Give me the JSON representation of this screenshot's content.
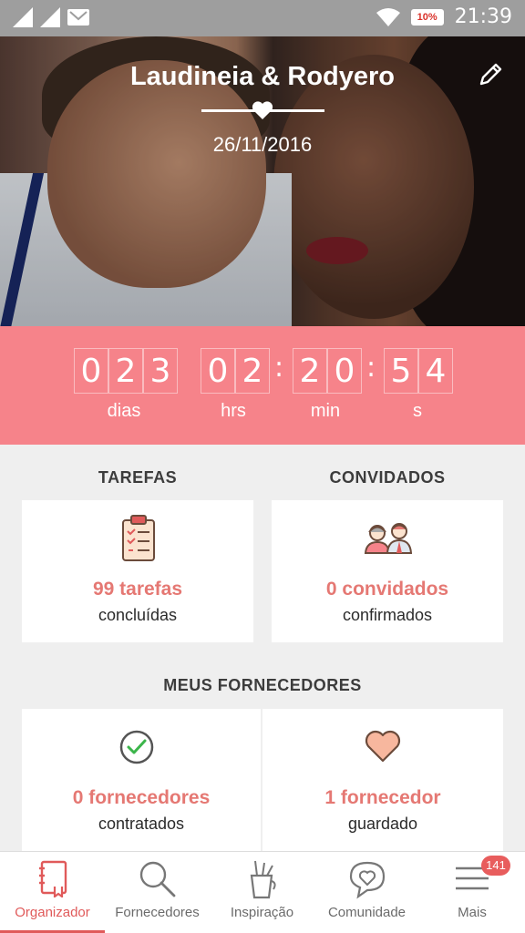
{
  "status_bar": {
    "time": "21:39",
    "battery": "10%"
  },
  "header": {
    "couple_names": "Laudineia & Rodyero",
    "wedding_date": "26/11/2016"
  },
  "countdown": {
    "days": [
      "0",
      "2",
      "3"
    ],
    "hours": [
      "0",
      "2"
    ],
    "minutes": [
      "2",
      "0"
    ],
    "seconds": [
      "5",
      "4"
    ],
    "labels": {
      "days": "dias",
      "hours": "hrs",
      "minutes": "min",
      "seconds": "s"
    }
  },
  "tasks": {
    "title": "TAREFAS",
    "count": "99 tarefas",
    "caption": "concluídas"
  },
  "guests": {
    "title": "CONVIDADOS",
    "count": "0 convidados",
    "caption": "confirmados"
  },
  "vendors": {
    "title": "MEUS FORNECEDORES",
    "hired": {
      "count": "0 fornecedores",
      "caption": "contratados"
    },
    "saved": {
      "count": "1 fornecedor",
      "caption": "guardado"
    }
  },
  "bottom_nav": {
    "items": [
      "Organizador",
      "Fornecedores",
      "Inspiração",
      "Comunidade",
      "Mais"
    ],
    "active": "Organizador",
    "badge": "141"
  },
  "colors": {
    "accent": "#f6838a",
    "link": "#e57873",
    "active": "#e05a5a"
  }
}
